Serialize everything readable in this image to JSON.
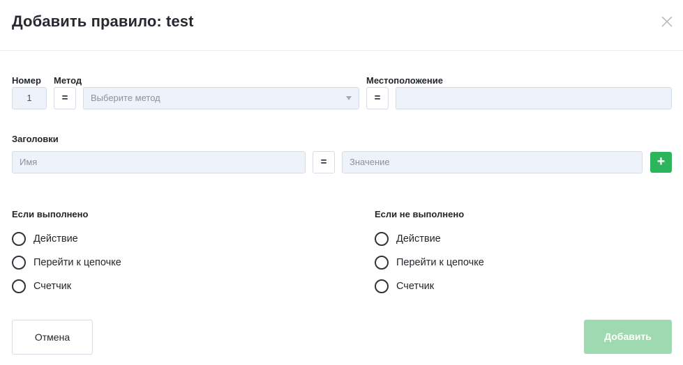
{
  "dialog": {
    "title": "Добавить правило: test",
    "close_icon": "close-icon"
  },
  "labels": {
    "number": "Номер",
    "method": "Метод",
    "location": "Местоположение",
    "headers": "Заголовки",
    "if_done": "Если выполнено",
    "if_not_done": "Если не выполнено"
  },
  "fields": {
    "number_value": "1",
    "method_operator": "=",
    "method_placeholder": "Выберите метод",
    "location_operator": "=",
    "location_value": "",
    "header_name_placeholder": "Имя",
    "header_operator": "=",
    "header_value_placeholder": "Значение",
    "add_header_label": "+"
  },
  "if_done": {
    "options": [
      "Действие",
      "Перейти к цепочке",
      "Счетчик"
    ]
  },
  "if_not_done": {
    "options": [
      "Действие",
      "Перейти к цепочке",
      "Счетчик"
    ]
  },
  "buttons": {
    "cancel": "Отмена",
    "add": "Добавить"
  },
  "colors": {
    "accent_green": "#2db55d",
    "disabled_green": "#9ed9b2",
    "field_bg": "#eef3fb"
  }
}
